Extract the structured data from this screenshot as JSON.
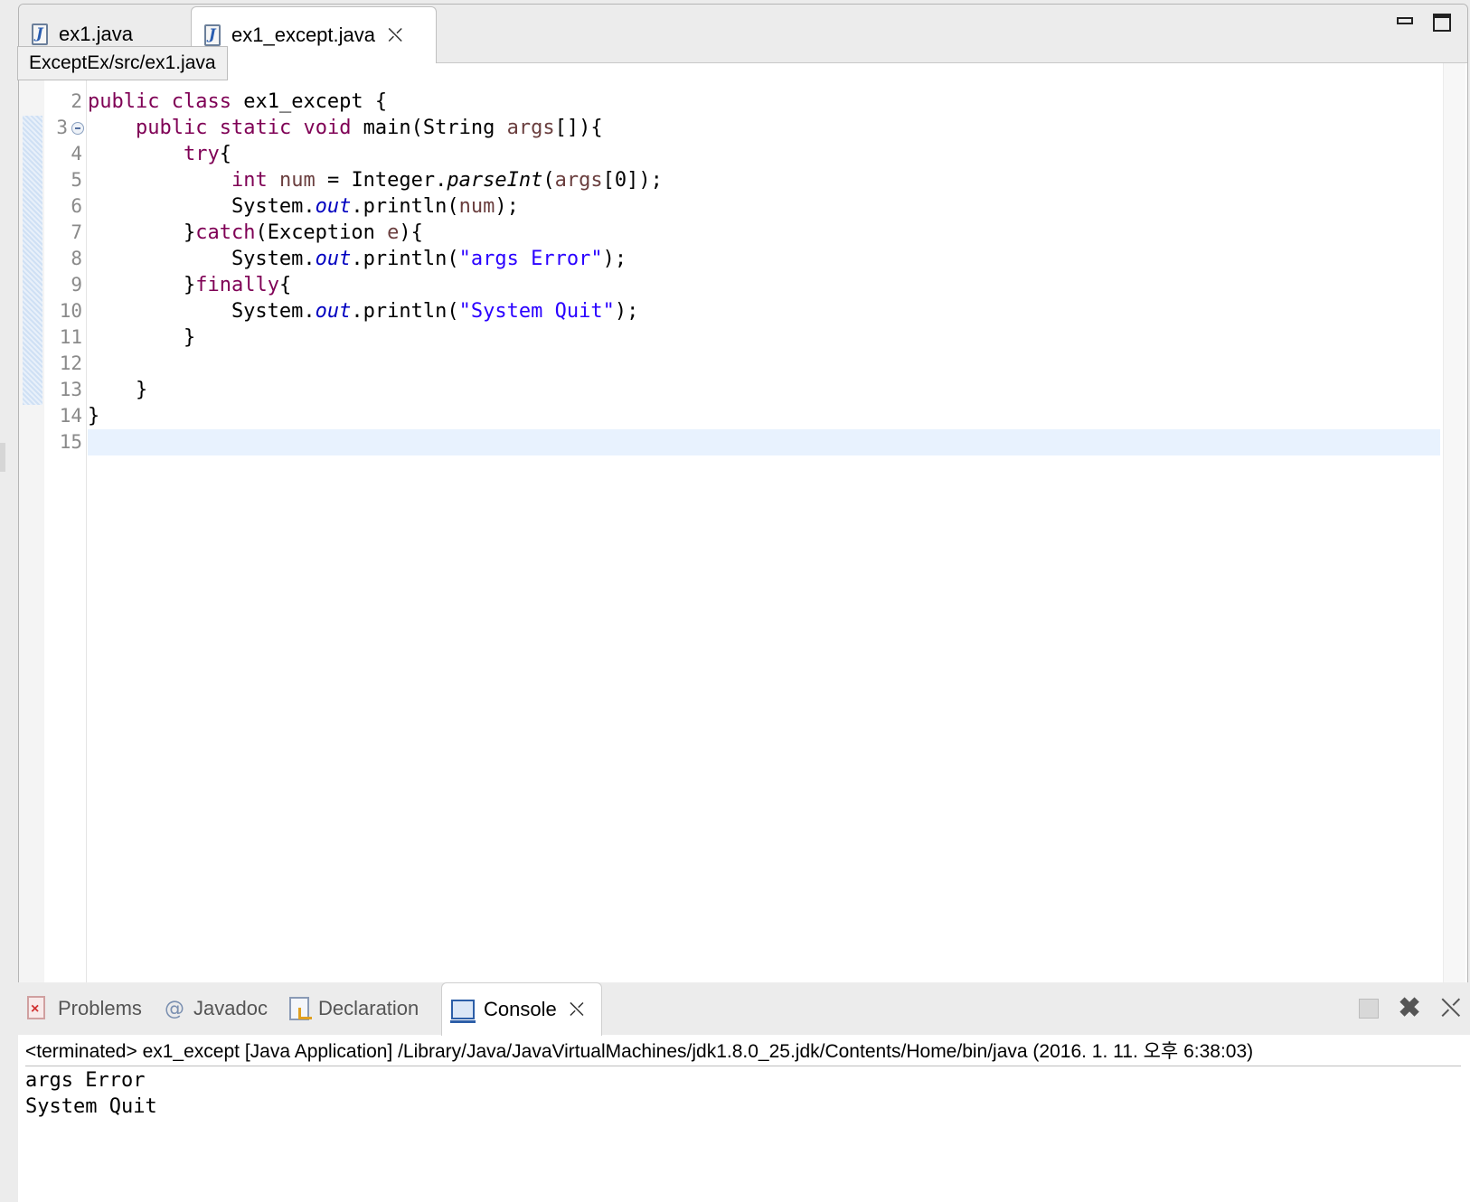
{
  "editor": {
    "tabs": [
      {
        "label": "ex1.java",
        "active": false
      },
      {
        "label": "ex1_except.java",
        "active": true
      }
    ],
    "tooltip": "ExceptEx/src/ex1.java",
    "line_numbers": [
      "2",
      "3",
      "4",
      "5",
      "6",
      "7",
      "8",
      "9",
      "10",
      "11",
      "12",
      "13",
      "14",
      "15"
    ],
    "current_line": "15",
    "code": {
      "l2": [
        "public",
        " ",
        "class",
        " ex1_except {"
      ],
      "l3": [
        "    ",
        "public",
        " ",
        "static",
        " ",
        "void",
        " main(String ",
        "args",
        "[]){"
      ],
      "l4": [
        "        ",
        "try",
        "{"
      ],
      "l5": [
        "            ",
        "int",
        " ",
        "num",
        " = Integer.",
        "parseInt",
        "(",
        "args",
        "[0]);"
      ],
      "l6": [
        "            System.",
        "out",
        ".println(",
        "num",
        ");"
      ],
      "l7": [
        "        }",
        "catch",
        "(Exception ",
        "e",
        "){"
      ],
      "l8": [
        "            System.",
        "out",
        ".println(",
        "\"args Error\"",
        ");"
      ],
      "l9": [
        "        }",
        "finally",
        "{"
      ],
      "l10": [
        "            System.",
        "out",
        ".println(",
        "\"System Quit\"",
        ");"
      ],
      "l11": [
        "        }"
      ],
      "l12": [
        ""
      ],
      "l13": [
        "    }"
      ],
      "l14": [
        "}"
      ],
      "l15": [
        ""
      ]
    }
  },
  "bottom_panel": {
    "tabs": [
      {
        "label": "Problems",
        "icon": "problems-icon"
      },
      {
        "label": "Javadoc",
        "icon": "javadoc-icon"
      },
      {
        "label": "Declaration",
        "icon": "declaration-icon"
      },
      {
        "label": "Console",
        "icon": "console-icon",
        "active": true
      }
    ],
    "console_header": "<terminated> ex1_except [Java Application] /Library/Java/JavaVirtualMachines/jdk1.8.0_25.jdk/Contents/Home/bin/java (2016. 1. 11. 오후 6:38:03)",
    "output": [
      "args Error",
      "System Quit"
    ]
  },
  "colors": {
    "keyword": "#7f0055",
    "string": "#2a00ff",
    "field": "#0000c0",
    "local_variable": "#6a3e3e",
    "current_line": "#e8f2fe"
  }
}
